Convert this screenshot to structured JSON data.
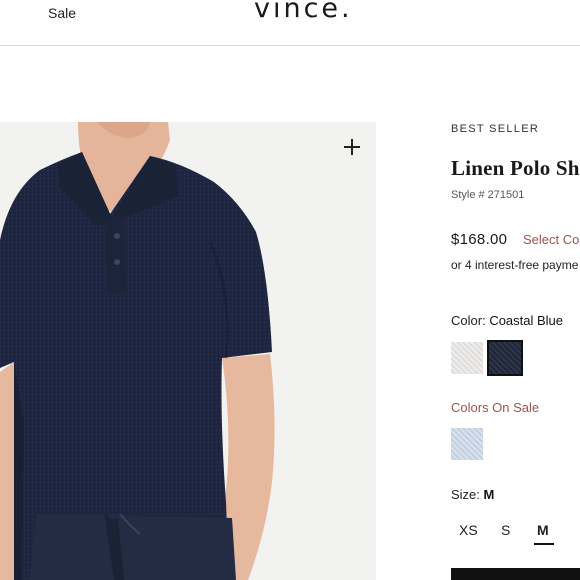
{
  "header": {
    "nav_sale": "Sale",
    "logo": "vince."
  },
  "product": {
    "badge": "BEST SELLER",
    "title": "Linen Polo Shi",
    "style_number": "Style # 271501",
    "price": "$168.00",
    "sale_link": "Select Co",
    "installments": "or 4 interest-free payme",
    "color_label": "Color:",
    "color_value": "Coastal Blue",
    "colors_on_sale_label": "Colors On Sale",
    "size_label": "Size:",
    "size_value": "M",
    "sizes": [
      "XS",
      "S",
      "M"
    ],
    "swatch_colors": {
      "white": "#e6e5e3",
      "coastal_blue": "#232b3f",
      "light_blue": "#c8d6e8"
    },
    "accent_color": "#a0524d"
  },
  "icons": {
    "zoom": "plus-icon"
  }
}
